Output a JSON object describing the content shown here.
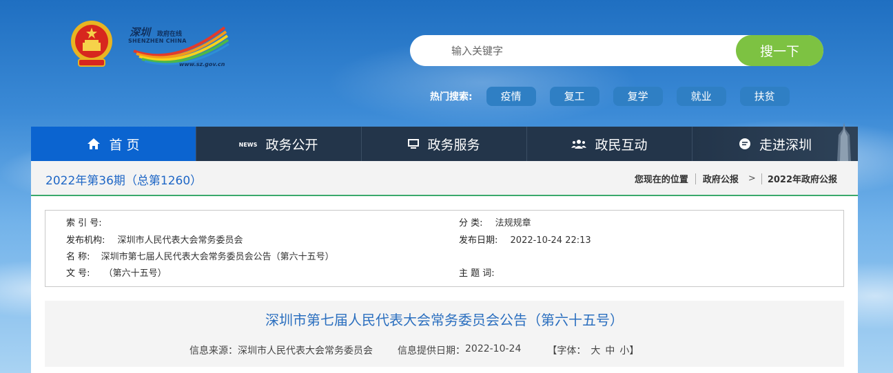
{
  "header": {
    "brand_cn": "深圳",
    "brand_cn2": "政府在线",
    "brand_en": "SHENZHEN CHINA",
    "brand_url": "www.sz.gov.cn",
    "search": {
      "placeholder": "输入关键字",
      "button": "搜一下"
    },
    "hot": {
      "label": "热门搜索:",
      "tags": [
        "疫情",
        "复工",
        "复学",
        "就业",
        "扶贫"
      ]
    }
  },
  "nav": [
    {
      "label": "首 页",
      "icon": "home-icon",
      "active": true
    },
    {
      "label": "政务公开",
      "icon": "news-icon"
    },
    {
      "label": "政务服务",
      "icon": "monitor-icon"
    },
    {
      "label": "政民互动",
      "icon": "people-icon"
    },
    {
      "label": "走进深圳",
      "icon": "chat-icon"
    }
  ],
  "crumb": {
    "issue": "2022年第36期（总第1260）",
    "location_label": "您现在的位置",
    "items": [
      "政府公报",
      "2022年政府公报"
    ],
    "gt": ">"
  },
  "meta": {
    "index_label": "索 引 号:",
    "index_value": "",
    "category_label": "分 类:",
    "category_value": "法规规章",
    "publisher_label": "发布机构:",
    "publisher_value": "深圳市人民代表大会常务委员会",
    "date_label": "发布日期:",
    "date_value": "2022-10-24 22:13",
    "name_label": "名 称:",
    "name_value": "深圳市第七届人民代表大会常务委员会公告（第六十五号）",
    "docno_label": "文 号:",
    "docno_value": "（第六十五号）",
    "subject_label": "主 题 词:",
    "subject_value": ""
  },
  "article": {
    "title": "深圳市第七届人民代表大会常务委员会公告（第六十五号）",
    "source_label": "信息来源：",
    "source_value": "深圳市人民代表大会常务委员会",
    "date_label": "信息提供日期：",
    "date_value": "2022-10-24",
    "font_open": "【字体：",
    "font_large": "大",
    "font_medium": "中",
    "font_small": "小",
    "font_close": "】"
  }
}
